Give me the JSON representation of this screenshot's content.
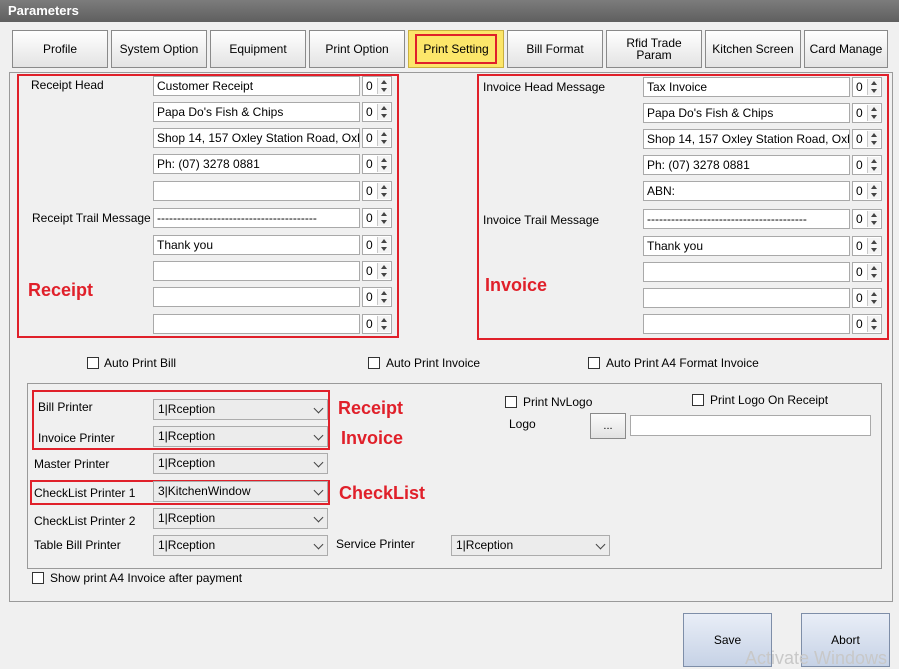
{
  "window": {
    "title": "Parameters"
  },
  "tabs": [
    {
      "label": "Profile"
    },
    {
      "label": "System Option"
    },
    {
      "label": "Equipment"
    },
    {
      "label": "Print Option"
    },
    {
      "label": "Print Setting"
    },
    {
      "label": "Bill Format"
    },
    {
      "label": "Rfid Trade Param"
    },
    {
      "label": "Kitchen Screen"
    },
    {
      "label": "Card Manage"
    }
  ],
  "receipt": {
    "head_label": "Receipt Head",
    "trail_label": "Receipt Trail Message",
    "annotation": "Receipt",
    "head_lines": [
      {
        "text": "Customer Receipt",
        "size": "0"
      },
      {
        "text": "Papa Do's Fish & Chips",
        "size": "0"
      },
      {
        "text": "Shop 14, 157 Oxley Station Road, Oxl",
        "size": "0"
      },
      {
        "text": "Ph: (07) 3278 0881",
        "size": "0"
      },
      {
        "text": "",
        "size": "0"
      }
    ],
    "trail_lines": [
      {
        "text": "----------------------------------------",
        "size": "0"
      },
      {
        "text": "Thank you",
        "size": "0"
      },
      {
        "text": "",
        "size": "0"
      },
      {
        "text": "",
        "size": "0"
      },
      {
        "text": "",
        "size": "0"
      }
    ]
  },
  "invoice": {
    "head_label": "Invoice Head Message",
    "trail_label": "Invoice Trail Message",
    "annotation": "Invoice",
    "head_lines": [
      {
        "text": "Tax Invoice",
        "size": "0"
      },
      {
        "text": "Papa Do's Fish & Chips",
        "size": "0"
      },
      {
        "text": "Shop 14, 157 Oxley Station Road, Oxl",
        "size": "0"
      },
      {
        "text": "Ph: (07) 3278 0881",
        "size": "0"
      },
      {
        "text": "ABN:",
        "size": "0"
      }
    ],
    "trail_lines": [
      {
        "text": "----------------------------------------",
        "size": "0"
      },
      {
        "text": "Thank you",
        "size": "0"
      },
      {
        "text": "",
        "size": "0"
      },
      {
        "text": "",
        "size": "0"
      },
      {
        "text": "",
        "size": "0"
      }
    ]
  },
  "options": {
    "auto_print_bill": "Auto Print Bill",
    "auto_print_invoice": "Auto Print Invoice",
    "auto_print_a4": "Auto Print A4 Format Invoice",
    "show_print_a4": "Show print A4 Invoice after payment"
  },
  "printers": {
    "bill_label": "Bill Printer",
    "bill_value": "1|Rception",
    "invoice_label": "Invoice Printer",
    "invoice_value": "1|Rception",
    "master_label": "Master Printer",
    "master_value": "1|Rception",
    "checklist1_label": "CheckList Printer 1",
    "checklist1_value": "3|KitchenWindow",
    "checklist2_label": "CheckList Printer 2",
    "checklist2_value": "1|Rception",
    "table_bill_label": "Table Bill Printer",
    "table_bill_value": "1|Rception",
    "service_label": "Service Printer",
    "service_value": "1|Rception"
  },
  "annotations": {
    "receipt": "Receipt",
    "invoice": "Invoice",
    "checklist": "CheckList"
  },
  "logo": {
    "print_nvlogo": "Print NvLogo",
    "print_logo_on_receipt": "Print Logo On Receipt",
    "logo_label": "Logo",
    "browse_label": "...",
    "path_value": ""
  },
  "actions": {
    "save": "Save",
    "abort": "Abort"
  },
  "watermark": "Activate Windows",
  "colors": {
    "highlight": "#e0202a",
    "active_tab": "#fce66a"
  }
}
